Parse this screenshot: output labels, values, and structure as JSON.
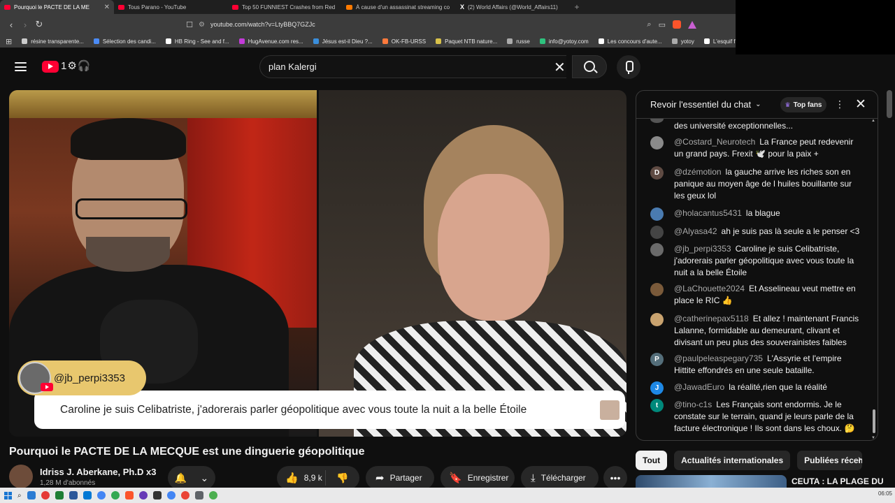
{
  "browser": {
    "tabs": [
      {
        "title": "Pourquoi le PACTE DE LA ME",
        "active": true,
        "color": "#ff0033"
      },
      {
        "title": "Tous Parano - YouTube",
        "active": false,
        "color": "#ff0033"
      },
      {
        "title": "Top 50 FUNNIEST Crashes from Red",
        "active": false,
        "color": "#ff0033"
      },
      {
        "title": "À cause d'un assassinat streaming co",
        "active": false,
        "color": "#ff7a00"
      },
      {
        "title": "(2) World Affairs (@World_Affairs11)",
        "active": false,
        "color": "#000000",
        "glyph": "X"
      }
    ],
    "new_tab": "+",
    "url": "youtube.com/watch?v=LtyBBQ7GZJc",
    "bookmarks": [
      {
        "label": "résine transparente...",
        "color": "#cccccc"
      },
      {
        "label": "Sélection des candi...",
        "color": "#4b8bf5"
      },
      {
        "label": "HB Ring - See and f...",
        "color": "#ffffff"
      },
      {
        "label": "HugAvenue.com res...",
        "color": "#c33bd9"
      },
      {
        "label": "Jésus est-il Dieu ?...",
        "color": "#3a8edb"
      },
      {
        "label": "OK-FB-URSS",
        "color": "#ff7a3c"
      },
      {
        "label": "Paquet NTB nature...",
        "color": "#d9c24a"
      },
      {
        "label": "russe",
        "color": "#aaaaaa"
      },
      {
        "label": "info@yotoy.com",
        "color": "#2ec27e"
      },
      {
        "label": "Les concours d'aute...",
        "color": "#ffffff"
      },
      {
        "label": "yotoy",
        "color": "#aaaaaa"
      },
      {
        "label": "L'esquif f",
        "color": "#ffffff"
      }
    ]
  },
  "youtube": {
    "search_value": "plan Kalergi",
    "logo_doodle": "1⚙🎧",
    "video": {
      "overlay_user": "@jb_perpi3353",
      "overlay_caption": "Caroline je suis Celibatriste, j'adorerais parler géopolitique avec vous toute la nuit a la belle Étoile"
    },
    "title": "Pourquoi le PACTE DE LA MECQUE est une dinguerie géopolitique",
    "channel": {
      "name": "Idriss J. Aberkane, Ph.D x3",
      "subs": "1,28 M d'abonnés"
    },
    "actions": {
      "likes": "8,9 k",
      "share": "Partager",
      "save": "Enregistrer",
      "download": "Télécharger",
      "more": "•••"
    },
    "chat": {
      "header": "Revoir l'essentiel du chat",
      "top_fans": "Top fans",
      "messages": [
        {
          "author": "",
          "text": "des université exceptionnelles...",
          "avatar_letter": "",
          "avatar_color": "#555555"
        },
        {
          "author": "@Costard_Neurotech",
          "text": "La France peut redevenir un grand pays. Frexit 🕊️ pour la paix +",
          "avatar_letter": "",
          "avatar_color": "#8a8a8a"
        },
        {
          "author": "@dzémotion",
          "text": "la gauche arrive les riches son en panique au moyen âge de l huiles bouillante sur les geux lol",
          "avatar_letter": "D",
          "avatar_color": "#5f4b43"
        },
        {
          "author": "@holacantus5431",
          "text": "la blague",
          "avatar_letter": "",
          "avatar_color": "#4a7bb0"
        },
        {
          "author": "@Alyasa42",
          "text": "ah je suis pas là seule a le penser <3",
          "avatar_letter": "",
          "avatar_color": "#444444"
        },
        {
          "author": "@jb_perpi3353",
          "text": "Caroline je suis Celibatriste, j'adorerais parler géopolitique avec vous toute la nuit a la belle Étoile",
          "avatar_letter": "",
          "avatar_color": "#6a6a6a"
        },
        {
          "author": "@LaChouette2024",
          "text": "Et Asselineau veut mettre en place le RIC 👍",
          "avatar_letter": "",
          "avatar_color": "#7a5a3a"
        },
        {
          "author": "@catherinepax5118",
          "text": "Et allez ! maintenant Francis Lalanne, formidable au demeurant, clivant et divisant un peu plus des souverainistes faibles",
          "avatar_letter": "",
          "avatar_color": "#c9a36f"
        },
        {
          "author": "@paulpeleaspegary735",
          "text": "L'Assyrie et l'empire Hittite effondrés en une seule bataille.",
          "avatar_letter": "P",
          "avatar_color": "#546e7a"
        },
        {
          "author": "@JawadEuro",
          "text": "la réalité,rien que la réalité",
          "avatar_letter": "J",
          "avatar_color": "#1e88e5"
        },
        {
          "author": "@tino-c1s",
          "text": "Les Français sont endormis. Je le constate sur le terrain, quand je leurs parle de la facture électronique ! Ils sont dans les choux. 🤔",
          "avatar_letter": "t",
          "avatar_color": "#00897b"
        }
      ]
    },
    "chips": [
      {
        "label": "Tout",
        "active": true
      },
      {
        "label": "Actualités internationales",
        "active": false
      },
      {
        "label": "Publiées récem",
        "active": false
      }
    ],
    "recommended_title": "CEUTA : LA PLAGE DU"
  },
  "taskbar": {
    "clock": "06:05"
  }
}
